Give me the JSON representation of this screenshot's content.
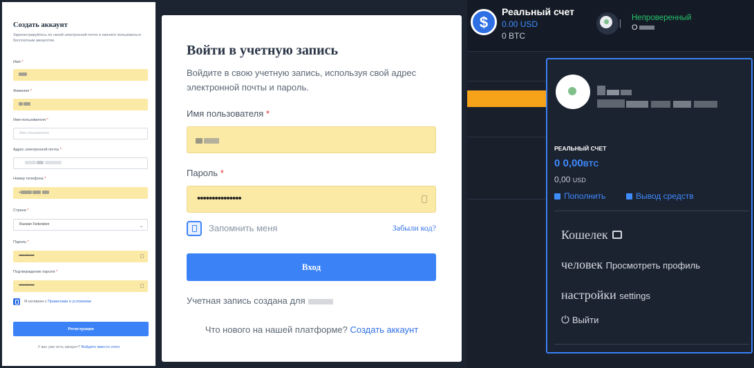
{
  "register": {
    "title": "Создать аккаунт",
    "subtitle": "Зарегистрируйтесь по своей электронной почте и начните пользоваться бесплатным аккаунтом.",
    "first_name_label": "Имя",
    "last_name_label": "Фамилия",
    "username_label": "Имя пользователя",
    "username_placeholder": "Имя пользователя",
    "email_label": "Адрес электронной почты",
    "phone_label": "Номер телефона",
    "phone_value": "+",
    "country_label": "Страна",
    "country_value": "Russian Federation",
    "password_label": "Пароль",
    "password_value": "••••••••••••••",
    "confirm_label": "Подтверждение пароля",
    "confirm_value": "••••••••••••••",
    "agree_text": "Я согласен с",
    "agree_link": "Правилами и условиями",
    "register_button": "Регистрация",
    "footer_text": "У вас уже есть аккаунт?",
    "footer_link": "Войдите вместо этого",
    "required_mark": "*"
  },
  "login": {
    "title": "Войти в учетную запись",
    "subtitle": "Войдите в свою учетную запись, используя свой адрес электронной почты и пароль.",
    "username_label": "Имя пользователя",
    "password_label": "Пароль",
    "password_value": "•••••••••••••••",
    "remember_label": "Запомнить меня",
    "forgot_link": "Забыли код?",
    "login_button": "Вход",
    "created_text": "Учетная запись создана для",
    "footer_text": "Что нового на нашей платформе?",
    "footer_link": "Создать аккаунт",
    "required_mark": "*"
  },
  "account": {
    "title": "Реальный счет",
    "usd_balance": "0.00 USD",
    "btc_balance": "0 BTC",
    "coin_symbol": "$",
    "status": "Непроверенный",
    "username_initial": "O",
    "dropdown": {
      "section_label": "РЕАЛЬНЫЙ СЧЕТ",
      "btc_amount": "0 0,00",
      "btc_unit": "BTC",
      "usd_amount": "0,00",
      "usd_unit": "USD",
      "deposit": "Пополнить",
      "withdraw": "Вывод средств",
      "wallet": "Кошелек",
      "person": "человек",
      "view_profile": "Просмотреть профиль",
      "settings": "настройки",
      "settings_en": "settings",
      "logout": "Выйти"
    },
    "colors": {
      "accent": "#3b82f6",
      "unverified": "#26c26b",
      "bar": "#f7a31a"
    }
  }
}
